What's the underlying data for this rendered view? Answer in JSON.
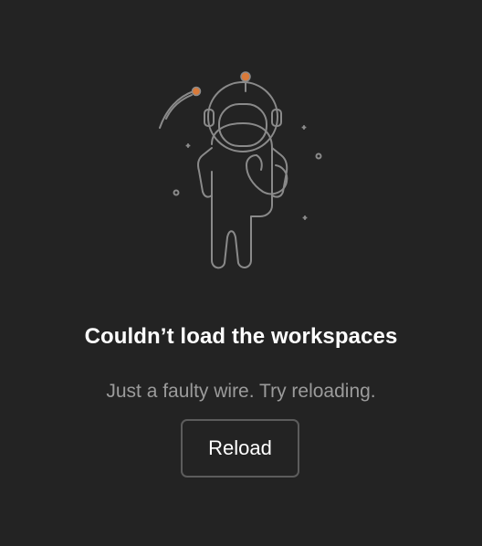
{
  "error": {
    "title": "Couldn’t load the workspaces",
    "message": "Just a faulty wire. Try reloading.",
    "reload_label": "Reload",
    "illustration_icon": "astronaut-icon"
  },
  "colors": {
    "background": "#232323",
    "title": "#ffffff",
    "message": "#9b9b9b",
    "button_border": "#5c5c5c",
    "illustration_stroke": "#8a8a8a",
    "accent_orange": "#d97a3a"
  }
}
